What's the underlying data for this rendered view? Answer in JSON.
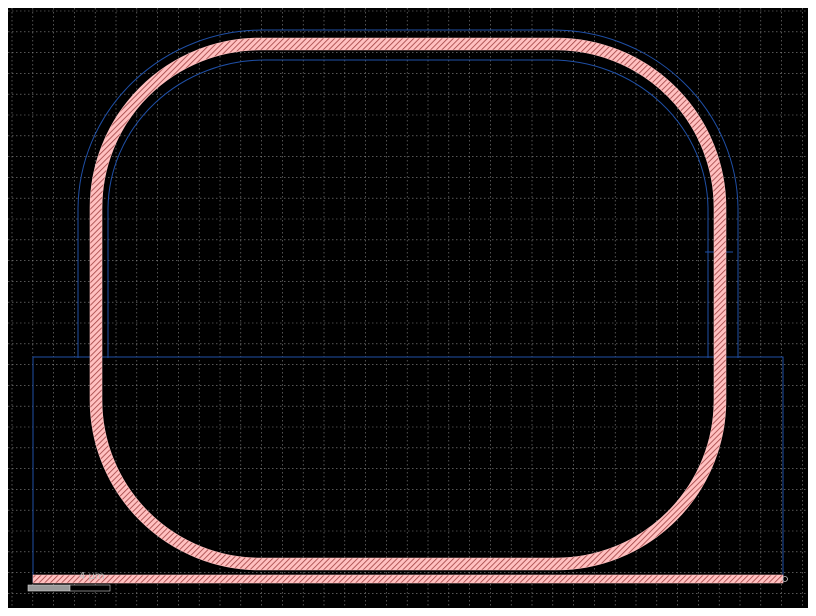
{
  "viewer": {
    "background_color": "#000000",
    "grid_color": "#8a8a8a",
    "waveguide_fill_color": "#ffc0c0",
    "waveguide_hatch_color": "#a04040",
    "outline_color": "#1f4fa6"
  },
  "scale_bar": {
    "label": "4 µm"
  }
}
